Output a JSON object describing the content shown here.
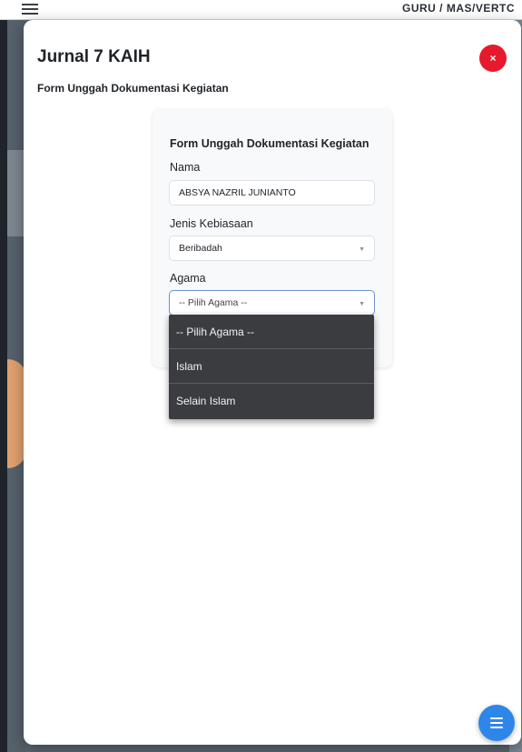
{
  "background": {
    "header_title": "GURU / MAS/VERTC"
  },
  "modal": {
    "title": "Jurnal 7 KAIH",
    "subtitle": "Form Unggah Dokumentasi Kegiatan",
    "close_icon": "×",
    "close_color": "#e8192c"
  },
  "form": {
    "title": "Form Unggah Dokumentasi Kegiatan",
    "nama": {
      "label": "Nama",
      "value": "ABSYA NAZRIL JUNIANTO"
    },
    "jenis_kebiasaan": {
      "label": "Jenis Kebiasaan",
      "value": "Beribadah"
    },
    "agama": {
      "label": "Agama",
      "value": "-- Pilih Agama --"
    }
  },
  "dropdown": {
    "options": [
      {
        "label": "-- Pilih Agama --"
      },
      {
        "label": "Islam"
      },
      {
        "label": "Selain Islam"
      }
    ]
  },
  "fab": {
    "icon": "menu-icon",
    "color": "#2f86e9"
  }
}
